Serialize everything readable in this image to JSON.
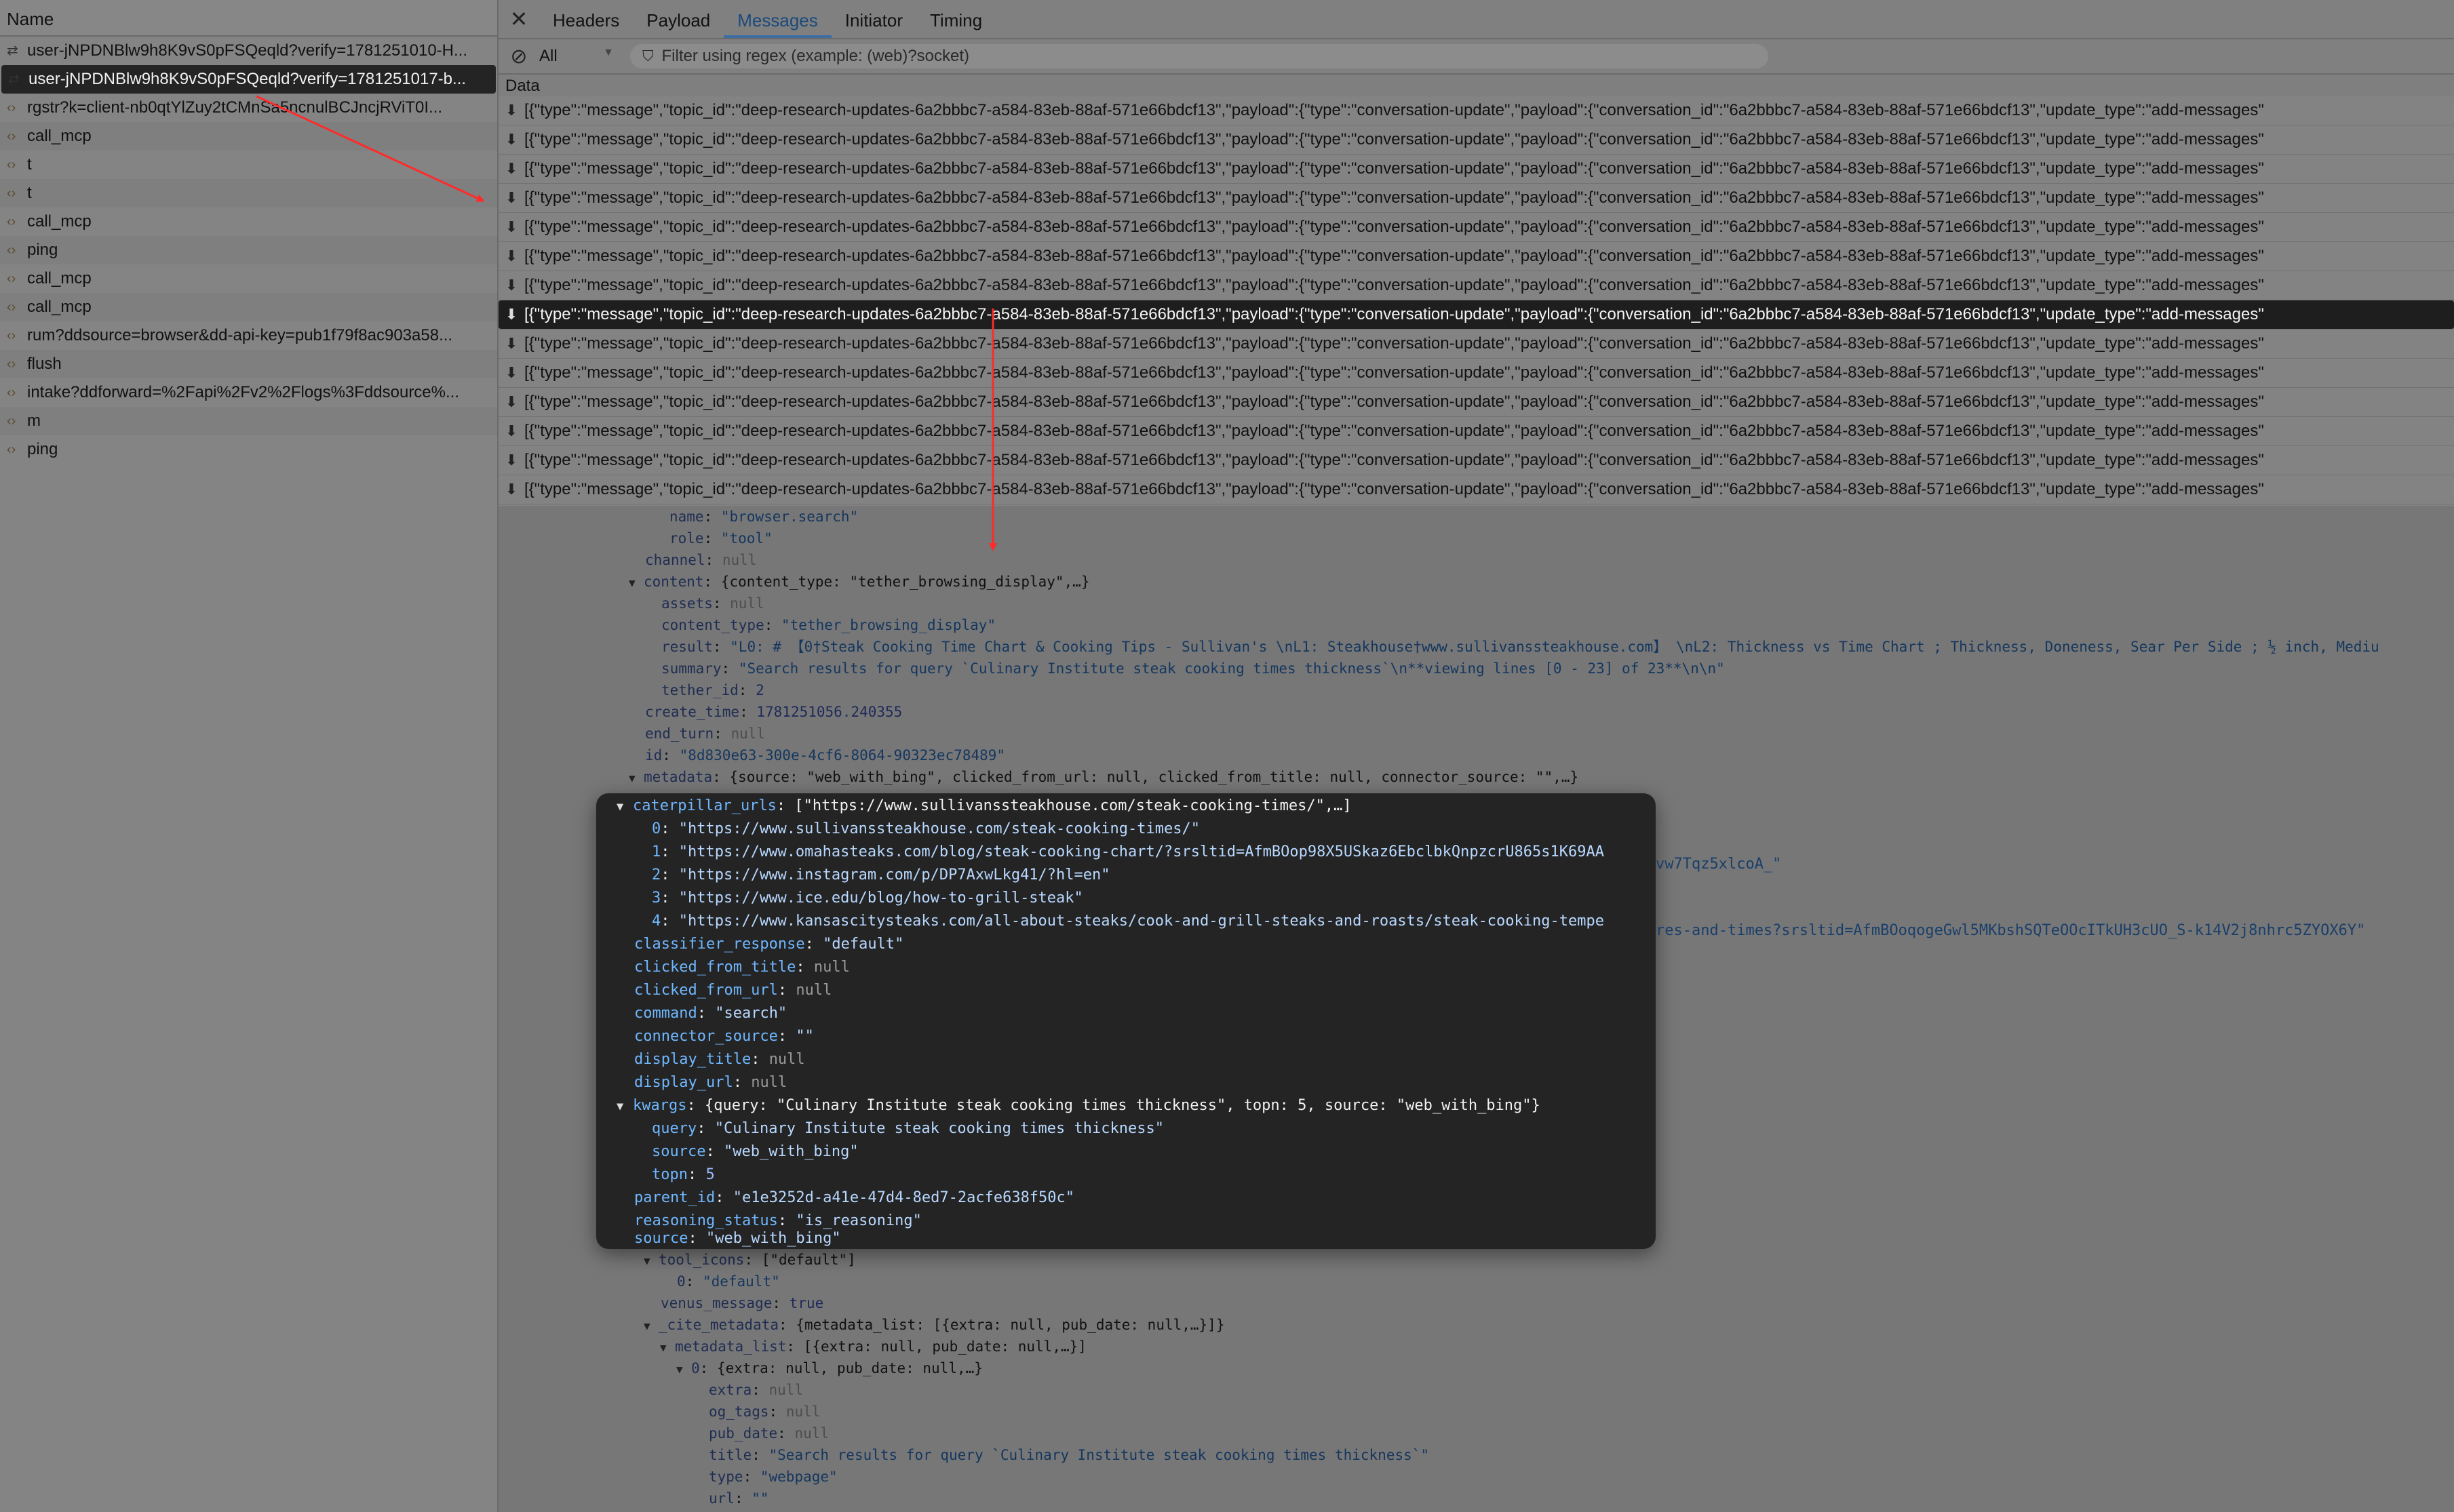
{
  "left_panel": {
    "header": "Name",
    "requests": [
      {
        "icon": "websocket-icon",
        "label": "user-jNPDNBlw9h8K9vS0pFSQeqld?verify=1781251010-H...",
        "selected": false
      },
      {
        "icon": "websocket-icon",
        "label": "user-jNPDNBlw9h8K9vS0pFSQeqld?verify=1781251017-b...",
        "selected": true
      },
      {
        "icon": "xhr-icon",
        "label": "rgstr?k=client-nb0qtYlZuy2tCMnSa5ncnulBCJncjRViT0I...",
        "selected": false
      },
      {
        "icon": "xhr-icon",
        "label": "call_mcp",
        "selected": false
      },
      {
        "icon": "xhr-icon",
        "label": "t",
        "selected": false
      },
      {
        "icon": "xhr-icon",
        "label": "t",
        "selected": false
      },
      {
        "icon": "xhr-icon",
        "label": "call_mcp",
        "selected": false
      },
      {
        "icon": "xhr-icon",
        "label": "ping",
        "selected": false
      },
      {
        "icon": "xhr-icon",
        "label": "call_mcp",
        "selected": false
      },
      {
        "icon": "xhr-icon",
        "label": "call_mcp",
        "selected": false
      },
      {
        "icon": "xhr-icon",
        "label": "rum?ddsource=browser&dd-api-key=pub1f79f8ac903a58...",
        "selected": false
      },
      {
        "icon": "xhr-icon",
        "label": "flush",
        "selected": false
      },
      {
        "icon": "xhr-icon",
        "label": "intake?ddforward=%2Fapi%2Fv2%2Flogs%3Fddsource%...",
        "selected": false
      },
      {
        "icon": "xhr-icon",
        "label": "m",
        "selected": false
      },
      {
        "icon": "xhr-icon",
        "label": "ping",
        "selected": false
      }
    ]
  },
  "tabs": {
    "close": "✕",
    "items": [
      "Headers",
      "Payload",
      "Messages",
      "Initiator",
      "Timing"
    ],
    "active": "Messages"
  },
  "filter": {
    "type_value": "All",
    "placeholder": "Filter using regex (example: (web)?socket)"
  },
  "messages": {
    "header": "Data",
    "row_text": "[{\"type\":\"message\",\"topic_id\":\"deep-research-updates-6a2bbbc7-a584-83eb-88af-571e66bdcf13\",\"payload\":{\"type\":\"conversation-update\",\"payload\":{\"conversation_id\":\"6a2bbbc7-a584-83eb-88af-571e66bdcf13\",\"update_type\":\"add-messages\"",
    "count": 15,
    "selected_index": 7
  },
  "tree_bg": {
    "name_key": "name",
    "name_val": "\"browser.search\"",
    "role_key": "role",
    "role_val": "\"tool\"",
    "channel_key": "channel",
    "channel_val": "null",
    "content_key": "content",
    "content_preview": "{content_type: \"tether_browsing_display\",…}",
    "assets_key": "assets",
    "assets_val": "null",
    "content_type_key": "content_type",
    "content_type_val": "\"tether_browsing_display\"",
    "result_key": "result",
    "result_val": "\"L0: #  【0†Steak Cooking Time Chart & Cooking Tips - Sullivan's \\nL1: Steakhouse†www.sullivanssteakhouse.com】 \\nL2: Thickness vs Time Chart ; Thickness, Doneness, Sear Per Side ; ½ inch, Mediu",
    "summary_key": "summary",
    "summary_val": "\"Search results for query `Culinary Institute steak cooking times thickness`\\n**viewing lines [0 - 23] of 23**\\n\\n\"",
    "tether_id_key": "tether_id",
    "tether_id_val": "2",
    "create_time_key": "create_time",
    "create_time_val": "1781251056.240355",
    "end_turn_key": "end_turn",
    "end_turn_val": "null",
    "id_key": "id",
    "id_val": "\"8d830e63-300e-4cf6-8064-90323ec78489\"",
    "metadata_key": "metadata",
    "metadata_preview": "{source: \"web_with_bing\", clicked_from_url: null, clicked_from_title: null, connector_source: \"\",…}",
    "tool_icons_key": "tool_icons",
    "tool_icons_preview": "[\"default\"]",
    "tool_icons_0": "\"default\"",
    "venus_key": "venus_message",
    "venus_val": "true",
    "cite_key": "_cite_metadata",
    "cite_preview": "{metadata_list: [{extra: null, pub_date: null,…}]}",
    "mlist_key": "metadata_list",
    "mlist_preview": "[{extra: null, pub_date: null,…}]",
    "m0_preview": "{extra: null, pub_date: null,…}",
    "extra_key": "extra",
    "extra_val": "null",
    "og_tags_key": "og_tags",
    "og_tags_val": "null",
    "pub_date_key": "pub_date",
    "pub_date_val": "null",
    "title_key": "title",
    "title_val": "\"Search results for query `Culinary Institute steak cooking times thickness`\"",
    "type_key": "type",
    "type_val": "\"webpage\"",
    "url_key": "url",
    "url_val": "\"\""
  },
  "popover": {
    "cat_key": "caterpillar_urls",
    "cat_preview": "[\"https://www.sullivanssteakhouse.com/steak-cooking-times/\",…]",
    "urls": [
      "\"https://www.sullivanssteakhouse.com/steak-cooking-times/\"",
      "\"https://www.omahasteaks.com/blog/steak-cooking-chart/?srsltid=AfmBOop98X5USkaz6EbclbkQnpzcrU865s1K69AA",
      "\"https://www.instagram.com/p/DP7AxwLkg41/?hl=en\"",
      "\"https://www.ice.edu/blog/how-to-grill-steak\"",
      "\"https://www.kansascitysteaks.com/all-about-steaks/cook-and-grill-steaks-and-roasts/steak-cooking-tempe"
    ],
    "url1_overflow": "vw7Tqz5xlcoA_\"",
    "url4_overflow": "res-and-times?srsltid=AfmBOoqogeGwl5MKbshSQTeOOcITkUH3cUO_S-k14V2j8nhrc5ZYOX6Y\"",
    "classifier_key": "classifier_response",
    "classifier_val": "\"default\"",
    "cft_key": "clicked_from_title",
    "cft_val": "null",
    "cfu_key": "clicked_from_url",
    "cfu_val": "null",
    "command_key": "command",
    "command_val": "\"search\"",
    "connector_key": "connector_source",
    "connector_val": "\"\"",
    "display_title_key": "display_title",
    "display_title_val": "null",
    "display_url_key": "display_url",
    "display_url_val": "null",
    "kwargs_key": "kwargs",
    "kwargs_preview": "{query: \"Culinary Institute steak cooking times thickness\", topn: 5, source: \"web_with_bing\"}",
    "query_key": "query",
    "query_val": "\"Culinary Institute steak cooking times thickness\"",
    "source_key": "source",
    "source_val": "\"web_with_bing\"",
    "topn_key": "topn",
    "topn_val": "5",
    "parent_key": "parent_id",
    "parent_val": "\"e1e3252d-a41e-47d4-8ed7-2acfe638f50c\"",
    "reasoning_key": "reasoning_status",
    "reasoning_val": "\"is_reasoning\"",
    "source2_key": "source",
    "source2_val": "\"web_with_bing\""
  },
  "colors": {
    "annotation_arrow": "#ff2a2a",
    "popover_bg": "#242424",
    "dim_bg": "#777777"
  }
}
